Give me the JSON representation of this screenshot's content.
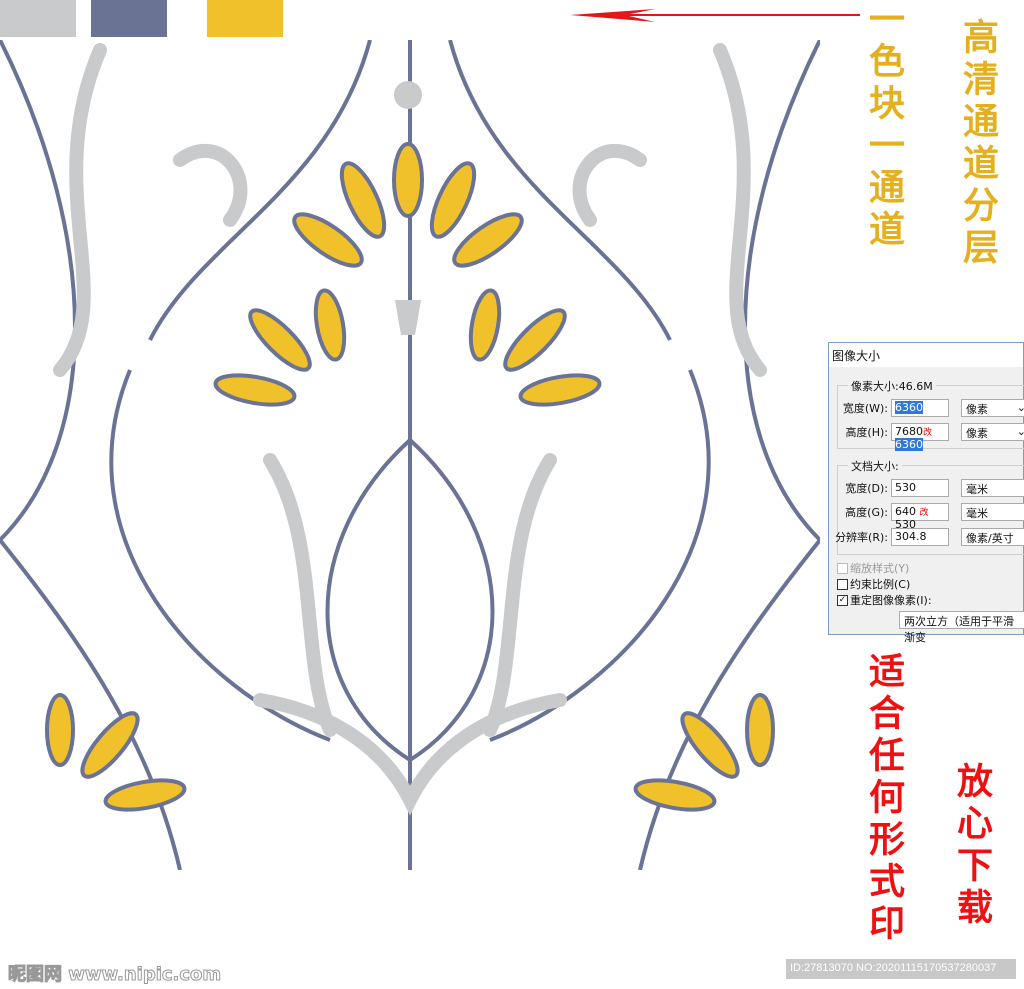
{
  "swatches": [
    "#c8cacc",
    "#6b7394",
    "#f1c12c"
  ],
  "colors": {
    "slate": "#6b7394",
    "gray": "#c8cacc",
    "yellow": "#f1c12c",
    "arrow": "#e01818"
  },
  "side_text": {
    "left_yellow": "一色块一通道",
    "right_yellow": "高清通道分层",
    "left_red": "适合任何形式印",
    "right_red": "放心下载"
  },
  "dialog": {
    "title": "图像大小",
    "pixel_group": "像素大小:46.6M",
    "width_label": "宽度(W):",
    "width_value": "6360",
    "width_unit": "像素",
    "height_label": "高度(H):",
    "height_value": "7680",
    "height_mark": "改",
    "height_new": "6360",
    "height_unit": "像素",
    "doc_group": "文档大小:",
    "doc_width_label": "宽度(D):",
    "doc_width_value": "530",
    "doc_width_unit": "毫米",
    "doc_height_label": "高度(G):",
    "doc_height_value": "640",
    "doc_height_mark": "改",
    "doc_height_new": "530",
    "doc_height_unit": "毫米",
    "res_label": "分辨率(R):",
    "res_value": "304.8",
    "res_unit": "像素/英寸",
    "scale_styles": "缩放样式(Y)",
    "constrain": "约束比例(C)",
    "resample": "重定图像像素(I):",
    "resample_method": "两次立方（适用于平滑渐变"
  },
  "watermark": "昵图网 www.nipic.com",
  "id_text": "ID:27813070 NO:20201115170537280037"
}
